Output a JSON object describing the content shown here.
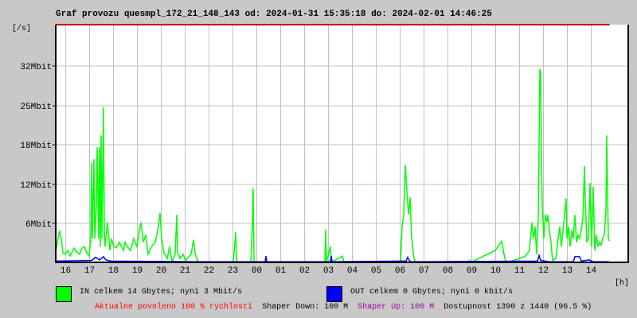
{
  "chart_data": {
    "type": "line",
    "title": "Graf provozu quesmpl_172_21_148_143 od: 2024-01-31 15:35:18 do: 2024-02-01 14:46:25",
    "ylabel": "[/s]",
    "xlabel": "[h]",
    "ylim": [
      0,
      38
    ],
    "xlim_minutes_from_start": [
      0,
      1391
    ],
    "grid": true,
    "y_ticks": [
      {
        "label": "6Mbit",
        "value": 6.2
      },
      {
        "label": "12Mbit",
        "value": 12.5
      },
      {
        "label": "18Mbit",
        "value": 18.8
      },
      {
        "label": "25Mbit",
        "value": 25.1
      },
      {
        "label": "32Mbit",
        "value": 31.4
      }
    ],
    "x_ticks": [
      {
        "label": "16",
        "min": 25
      },
      {
        "label": "17",
        "min": 85
      },
      {
        "label": "18",
        "min": 145
      },
      {
        "label": "19",
        "min": 205
      },
      {
        "label": "20",
        "min": 265
      },
      {
        "label": "21",
        "min": 325
      },
      {
        "label": "22",
        "min": 385
      },
      {
        "label": "23",
        "min": 445
      },
      {
        "label": "00",
        "min": 505
      },
      {
        "label": "01",
        "min": 565
      },
      {
        "label": "02",
        "min": 625
      },
      {
        "label": "03",
        "min": 685
      },
      {
        "label": "04",
        "min": 745
      },
      {
        "label": "05",
        "min": 805
      },
      {
        "label": "06",
        "min": 865
      },
      {
        "label": "07",
        "min": 925
      },
      {
        "label": "08",
        "min": 985
      },
      {
        "label": "09",
        "min": 1045
      },
      {
        "label": "10",
        "min": 1105
      },
      {
        "label": "11",
        "min": 1165
      },
      {
        "label": "12",
        "min": 1225
      },
      {
        "label": "13",
        "min": 1285
      },
      {
        "label": "14",
        "min": 1345
      }
    ],
    "series": [
      {
        "name": "IN",
        "color": "#00ff00",
        "unit": "Mbit/s",
        "points": [
          [
            0,
            1.5
          ],
          [
            4,
            3.2
          ],
          [
            10,
            5.1
          ],
          [
            14,
            3.8
          ],
          [
            18,
            1.5
          ],
          [
            24,
            1.3
          ],
          [
            30,
            1.9
          ],
          [
            36,
            1.0
          ],
          [
            40,
            1.5
          ],
          [
            46,
            2.3
          ],
          [
            52,
            1.7
          ],
          [
            60,
            1.3
          ],
          [
            66,
            2.3
          ],
          [
            72,
            2.5
          ],
          [
            78,
            1.5
          ],
          [
            84,
            1.0
          ],
          [
            88,
            3.8
          ],
          [
            90,
            15.9
          ],
          [
            92,
            3.8
          ],
          [
            96,
            16.5
          ],
          [
            98,
            3.8
          ],
          [
            102,
            8.9
          ],
          [
            104,
            18.4
          ],
          [
            108,
            3.8
          ],
          [
            110,
            18.4
          ],
          [
            112,
            2.5
          ],
          [
            114,
            20.3
          ],
          [
            116,
            3.8
          ],
          [
            120,
            24.8
          ],
          [
            122,
            5.1
          ],
          [
            124,
            2.5
          ],
          [
            130,
            6.4
          ],
          [
            136,
            1.9
          ],
          [
            140,
            3.8
          ],
          [
            146,
            2.5
          ],
          [
            152,
            2.3
          ],
          [
            160,
            3.2
          ],
          [
            170,
            1.9
          ],
          [
            174,
            3.2
          ],
          [
            180,
            2.5
          ],
          [
            188,
            1.9
          ],
          [
            196,
            3.8
          ],
          [
            204,
            2.5
          ],
          [
            210,
            5.1
          ],
          [
            214,
            6.4
          ],
          [
            220,
            3.2
          ],
          [
            226,
            4.4
          ],
          [
            232,
            1.3
          ],
          [
            240,
            2.5
          ],
          [
            250,
            3.2
          ],
          [
            256,
            5.1
          ],
          [
            262,
            7.9
          ],
          [
            266,
            3.8
          ],
          [
            272,
            1.5
          ],
          [
            280,
            0.6
          ],
          [
            286,
            2.5
          ],
          [
            292,
            0.1
          ],
          [
            300,
            1.3
          ],
          [
            304,
            7.6
          ],
          [
            306,
            1.5
          ],
          [
            312,
            0.6
          ],
          [
            320,
            1.3
          ],
          [
            326,
            0.3
          ],
          [
            340,
            1.3
          ],
          [
            346,
            3.6
          ],
          [
            350,
            1.5
          ],
          [
            354,
            0.6
          ],
          [
            360,
            0
          ],
          [
            446,
            0
          ],
          [
            452,
            4.8
          ],
          [
            454,
            0
          ],
          [
            490,
            0
          ],
          [
            494,
            6.1
          ],
          [
            496,
            11.9
          ],
          [
            498,
            0
          ],
          [
            676,
            0
          ],
          [
            678,
            5.3
          ],
          [
            680,
            0
          ],
          [
            690,
            2.5
          ],
          [
            692,
            0
          ],
          [
            720,
            1.0
          ],
          [
            724,
            0
          ],
          [
            866,
            0
          ],
          [
            870,
            5.7
          ],
          [
            874,
            7.6
          ],
          [
            878,
            15.6
          ],
          [
            882,
            11.4
          ],
          [
            886,
            7.6
          ],
          [
            890,
            10.4
          ],
          [
            894,
            3.8
          ],
          [
            900,
            0.6
          ],
          [
            904,
            0
          ],
          [
            1036,
            0
          ],
          [
            1040,
            0.3
          ],
          [
            1042,
            0
          ],
          [
            1104,
            1.9
          ],
          [
            1120,
            3.4
          ],
          [
            1128,
            0.6
          ],
          [
            1132,
            0
          ],
          [
            1160,
            0.5
          ],
          [
            1180,
            1.0
          ],
          [
            1190,
            1.9
          ],
          [
            1196,
            6.4
          ],
          [
            1200,
            3.8
          ],
          [
            1204,
            5.7
          ],
          [
            1208,
            1.3
          ],
          [
            1212,
            7.0
          ],
          [
            1216,
            30.9
          ],
          [
            1218,
            30.5
          ],
          [
            1220,
            16.5
          ],
          [
            1222,
            8.9
          ],
          [
            1226,
            3.8
          ],
          [
            1230,
            7.6
          ],
          [
            1234,
            6.4
          ],
          [
            1236,
            7.6
          ],
          [
            1240,
            5.1
          ],
          [
            1244,
            3.2
          ],
          [
            1248,
            0.3
          ],
          [
            1256,
            0.6
          ],
          [
            1262,
            3.8
          ],
          [
            1266,
            5.7
          ],
          [
            1270,
            2.5
          ],
          [
            1282,
            10.2
          ],
          [
            1284,
            3.8
          ],
          [
            1288,
            5.7
          ],
          [
            1292,
            2.5
          ],
          [
            1296,
            5.1
          ],
          [
            1300,
            3.8
          ],
          [
            1304,
            7.6
          ],
          [
            1308,
            3.2
          ],
          [
            1312,
            4.4
          ],
          [
            1316,
            3.8
          ],
          [
            1320,
            5.1
          ],
          [
            1324,
            7.0
          ],
          [
            1328,
            15.4
          ],
          [
            1330,
            10.2
          ],
          [
            1334,
            3.2
          ],
          [
            1338,
            3.8
          ],
          [
            1342,
            12.7
          ],
          [
            1346,
            2.5
          ],
          [
            1350,
            12.1
          ],
          [
            1354,
            1.9
          ],
          [
            1358,
            4.4
          ],
          [
            1362,
            2.5
          ],
          [
            1366,
            3.2
          ],
          [
            1370,
            2.8
          ],
          [
            1374,
            3.8
          ],
          [
            1378,
            4.4
          ],
          [
            1382,
            8.3
          ],
          [
            1384,
            20.3
          ],
          [
            1386,
            11.4
          ],
          [
            1388,
            3.8
          ],
          [
            1390,
            3.4
          ]
        ]
      },
      {
        "name": "OUT",
        "color": "#0000ff",
        "unit": "Mbit/s",
        "points": [
          [
            0,
            0.2
          ],
          [
            90,
            0.3
          ],
          [
            94,
            0.5
          ],
          [
            100,
            0.8
          ],
          [
            110,
            0.4
          ],
          [
            120,
            0.9
          ],
          [
            124,
            0.5
          ],
          [
            130,
            0.3
          ],
          [
            140,
            0.2
          ],
          [
            360,
            0.1
          ],
          [
            526,
            0.1
          ],
          [
            528,
            1.0
          ],
          [
            530,
            0.1
          ],
          [
            690,
            0.1
          ],
          [
            692,
            1.0
          ],
          [
            694,
            0.1
          ],
          [
            880,
            0.2
          ],
          [
            884,
            0.8
          ],
          [
            888,
            0.3
          ],
          [
            892,
            0.1
          ],
          [
            1210,
            0.2
          ],
          [
            1214,
            1.1
          ],
          [
            1218,
            0.3
          ],
          [
            1240,
            0.1
          ],
          [
            1300,
            0.1
          ],
          [
            1304,
            0.9
          ],
          [
            1316,
            0.9
          ],
          [
            1320,
            0.2
          ],
          [
            1340,
            0.4
          ],
          [
            1350,
            0.1
          ],
          [
            1390,
            0.1
          ]
        ]
      }
    ],
    "legend": {
      "in_text": "IN celkem 14 Gbytes; nyní 3 Mbit/s",
      "out_text": "OUT celkem 0 Gbytes; nyní 0 kbit/s"
    }
  },
  "footer": {
    "allowed": "Aktualne povoleno 100 % rychlosti",
    "shaper_down_label": "Shaper Down:",
    "shaper_down_value": "100 M",
    "shaper_up_label": "Shaper Up:",
    "shaper_up_value": "100 M",
    "availability": "Dostupnost 1390 z 1440 (96.5 %)"
  },
  "colors": {
    "allowed": "#ff0000",
    "shaper_up": "#990099",
    "limit_line": "#cc0000"
  }
}
